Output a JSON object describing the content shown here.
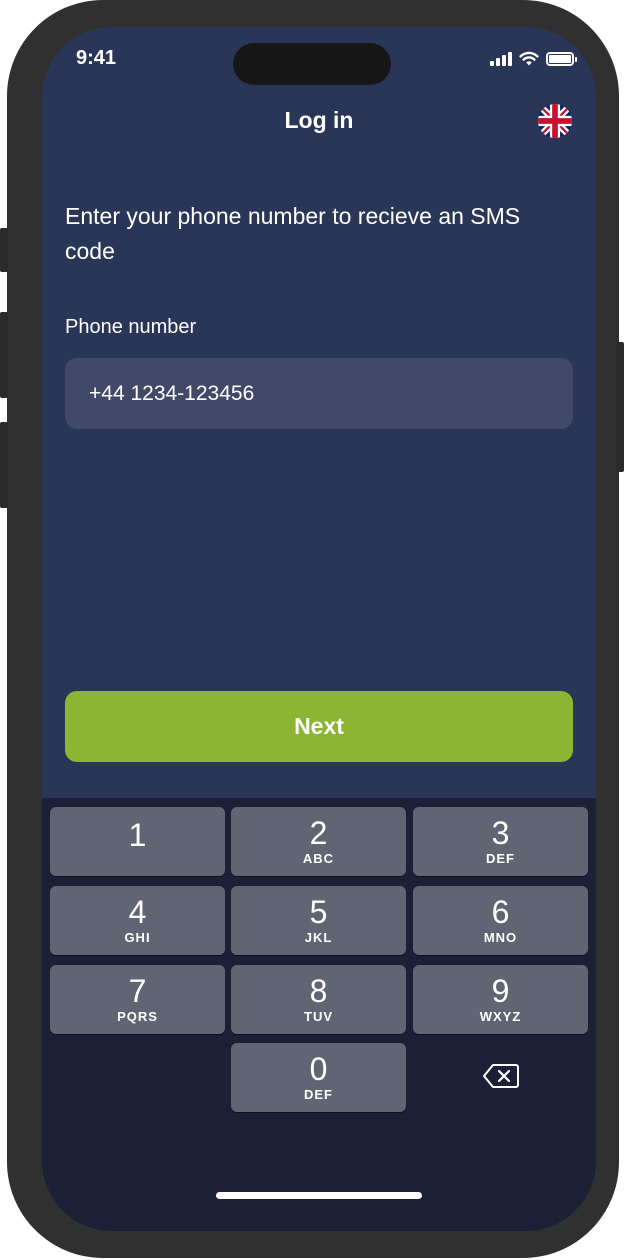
{
  "status_bar": {
    "time": "9:41",
    "signal_icon": "cellular-signal-icon",
    "wifi_icon": "wifi-icon",
    "battery_icon": "battery-icon"
  },
  "header": {
    "title": "Log in",
    "language_icon": "uk-flag-icon"
  },
  "form": {
    "instruction": "Enter your phone number to recieve an SMS code",
    "phone_label": "Phone number",
    "phone_value": "+44 1234-123456"
  },
  "actions": {
    "next_label": "Next"
  },
  "keypad": {
    "keys": [
      {
        "num": "1",
        "letters": ""
      },
      {
        "num": "2",
        "letters": "ABC"
      },
      {
        "num": "3",
        "letters": "DEF"
      },
      {
        "num": "4",
        "letters": "GHI"
      },
      {
        "num": "5",
        "letters": "JKL"
      },
      {
        "num": "6",
        "letters": "MNO"
      },
      {
        "num": "7",
        "letters": "PQRS"
      },
      {
        "num": "8",
        "letters": "TUV"
      },
      {
        "num": "9",
        "letters": "WXYZ"
      },
      {
        "num": "0",
        "letters": "DEF"
      }
    ],
    "delete_icon": "backspace-icon"
  },
  "colors": {
    "screen_background": "#2a3658",
    "input_background": "#404a68",
    "accent_green": "#8bb533",
    "keypad_background": "#1b2036",
    "key_background": "#606574"
  }
}
